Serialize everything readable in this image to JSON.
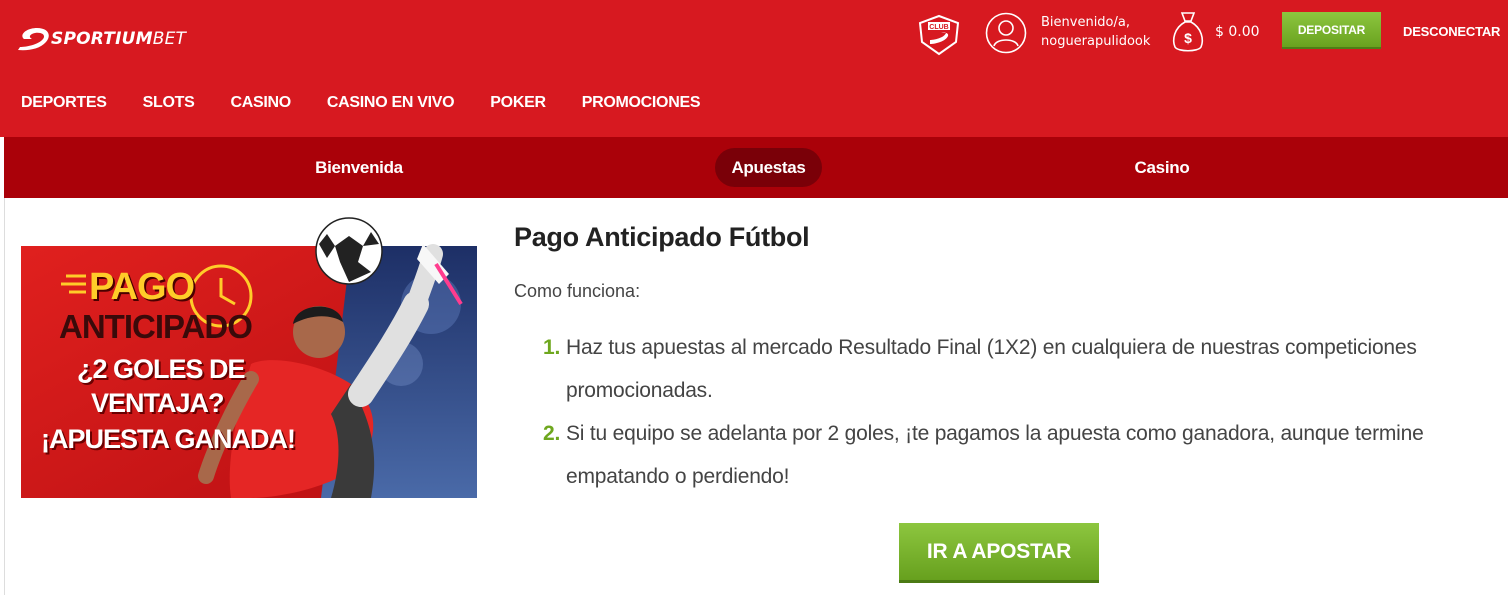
{
  "brand": {
    "logo_bold": "SPORTIUM",
    "logo_light": "BET",
    "primary_color": "#d71920",
    "secondary_color": "#aa0109",
    "accent_green": "#7cb82f"
  },
  "header": {
    "club_icon": "club-badge-icon",
    "club_label": "CLUB",
    "user_icon": "user-avatar-icon",
    "welcome_line1": "Bienvenido/a,",
    "welcome_line2": "noguerapulidook",
    "wallet_icon": "money-bag-icon",
    "balance": "$ 0.00",
    "deposit_label": "DEPOSITAR",
    "logout_label": "DESCONECTAR"
  },
  "main_nav": [
    "DEPORTES",
    "SLOTS",
    "CASINO",
    "CASINO EN VIVO",
    "POKER",
    "PROMOCIONES"
  ],
  "sub_nav": {
    "tabs": [
      "Bienvenida",
      "Apuestas",
      "Casino"
    ],
    "active": "Apuestas"
  },
  "banner": {
    "line1": "PAGO",
    "line2": "ANTICIPADO",
    "line3": "¿2 GOLES DE",
    "line4": "VENTAJA?",
    "line5": "¡APUESTA GANADA!"
  },
  "promo": {
    "title": "Pago Anticipado Fútbol",
    "subtitle": "Como funciona:",
    "steps": [
      {
        "num": "1.",
        "text": "Haz tus apuestas al mercado Resultado Final (1X2) en cualquiera de nuestras competiciones promocionadas."
      },
      {
        "num": "2.",
        "text": "Si tu equipo se adelanta por 2 goles, ¡te pagamos la apuesta como ganadora, aunque termine empatando o perdiendo!"
      }
    ],
    "cta_label": "IR A APOSTAR"
  }
}
